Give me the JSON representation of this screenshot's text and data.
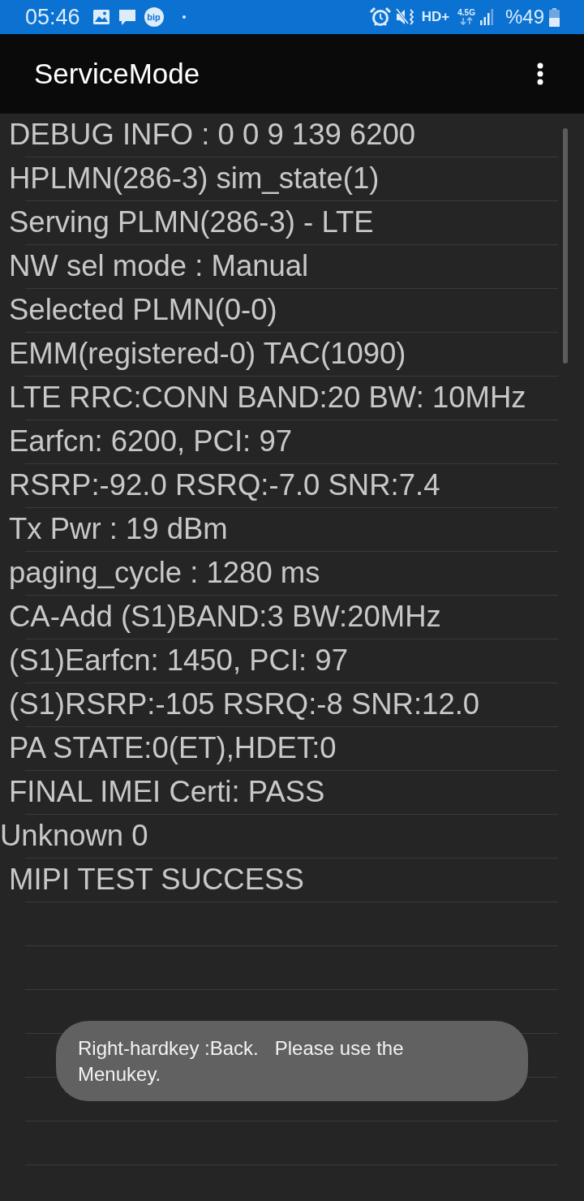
{
  "status_bar": {
    "time": "05:46",
    "notification_app": "bip",
    "network": "HD+",
    "data_type": "4.5G",
    "battery": "%49"
  },
  "app_bar": {
    "title": "ServiceMode"
  },
  "info_lines": [
    {
      "text": "DEBUG INFO : 0 0 9 139 6200",
      "indented": true
    },
    {
      "text": "HPLMN(286-3) sim_state(1)",
      "indented": true
    },
    {
      "text": "Serving PLMN(286-3) - LTE",
      "indented": true
    },
    {
      "text": "NW sel mode : Manual",
      "indented": true
    },
    {
      "text": "Selected PLMN(0-0)",
      "indented": true
    },
    {
      "text": "EMM(registered-0) TAC(1090)",
      "indented": true
    },
    {
      "text": "LTE RRC:CONN BAND:20 BW: 10MHz",
      "indented": true
    },
    {
      "text": "Earfcn: 6200, PCI: 97",
      "indented": true
    },
    {
      "text": "RSRP:-92.0 RSRQ:-7.0 SNR:7.4",
      "indented": true
    },
    {
      "text": "Tx Pwr : 19 dBm",
      "indented": true
    },
    {
      "text": "paging_cycle : 1280 ms",
      "indented": true
    },
    {
      "text": "CA-Add (S1)BAND:3 BW:20MHz",
      "indented": true
    },
    {
      "text": "(S1)Earfcn: 1450, PCI: 97",
      "indented": true
    },
    {
      "text": "(S1)RSRP:-105 RSRQ:-8 SNR:12.0",
      "indented": true
    },
    {
      "text": "PA STATE:0(ET),HDET:0",
      "indented": true
    },
    {
      "text": "FINAL IMEI Certi: PASS",
      "indented": true
    },
    {
      "text": "Unknown 0",
      "indented": false
    },
    {
      "text": "MIPI TEST SUCCESS",
      "indented": true
    }
  ],
  "toast": {
    "text": "Right-hardkey :Back.   Please use the Menukey."
  }
}
